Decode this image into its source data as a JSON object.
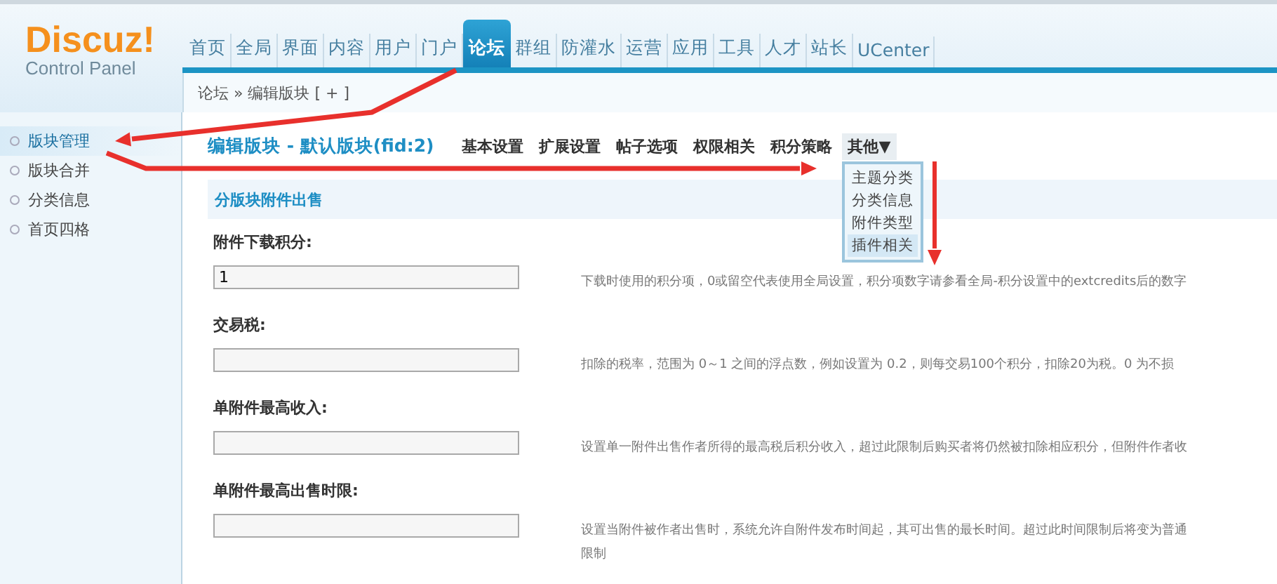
{
  "logo": {
    "title": "Discuz!",
    "subtitle": "Control Panel"
  },
  "nav": [
    {
      "label": "首页",
      "selected": false
    },
    {
      "label": "全局",
      "selected": false
    },
    {
      "label": "界面",
      "selected": false
    },
    {
      "label": "内容",
      "selected": false
    },
    {
      "label": "用户",
      "selected": false
    },
    {
      "label": "门户",
      "selected": false
    },
    {
      "label": "论坛",
      "selected": true
    },
    {
      "label": "群组",
      "selected": false
    },
    {
      "label": "防灌水",
      "selected": false
    },
    {
      "label": "运营",
      "selected": false
    },
    {
      "label": "应用",
      "selected": false
    },
    {
      "label": "工具",
      "selected": false
    },
    {
      "label": "人才",
      "selected": false
    },
    {
      "label": "站长",
      "selected": false
    },
    {
      "label": "UCenter",
      "selected": false
    }
  ],
  "breadcrumb": "论坛 » 编辑版块 [ + ]",
  "sidebar": {
    "items": [
      {
        "label": "版块管理",
        "selected": true
      },
      {
        "label": "版块合并",
        "selected": false
      },
      {
        "label": "分类信息",
        "selected": false
      },
      {
        "label": "首页四格",
        "selected": false
      }
    ]
  },
  "page_title": "编辑版块 - 默认版块(fid:2)",
  "tabs": [
    {
      "label": "基本设置",
      "selected": false
    },
    {
      "label": "扩展设置",
      "selected": false
    },
    {
      "label": "帖子选项",
      "selected": false
    },
    {
      "label": "权限相关",
      "selected": false
    },
    {
      "label": "积分策略",
      "selected": false
    },
    {
      "label": "其他▼",
      "selected": true
    }
  ],
  "dropdown": {
    "items": [
      {
        "label": "主题分类",
        "selected": false
      },
      {
        "label": "分类信息",
        "selected": false
      },
      {
        "label": "附件类型",
        "selected": false
      },
      {
        "label": "插件相关",
        "selected": true
      }
    ]
  },
  "section_title": "分版块附件出售",
  "fields": [
    {
      "label": "附件下载积分:",
      "value": "1",
      "description": [
        "下载时使用的积分项，0或留空代表使用全局设置，积分项数字请参看全局-积分设置中的extcredits后的数字"
      ]
    },
    {
      "label": "交易税:",
      "description": [
        "扣除的税率，范围为 0～1 之间的浮点数，例如设置为 0.2，则每交易100个积分，扣除20为税。0 为不损"
      ]
    },
    {
      "label": "单附件最高收入:",
      "description": [
        "设置单一附件出售作者所得的最高税后积分收入，超过此限制后购买者将仍然被扣除相应积分，但附件作者收"
      ]
    },
    {
      "label": "单附件最高出售时限:",
      "description": [
        "设置当附件被作者出售时，系统允许自附件发布时间起，其可出售的最长时间。超过此时间限制后将变为普通",
        "限制"
      ]
    }
  ]
}
